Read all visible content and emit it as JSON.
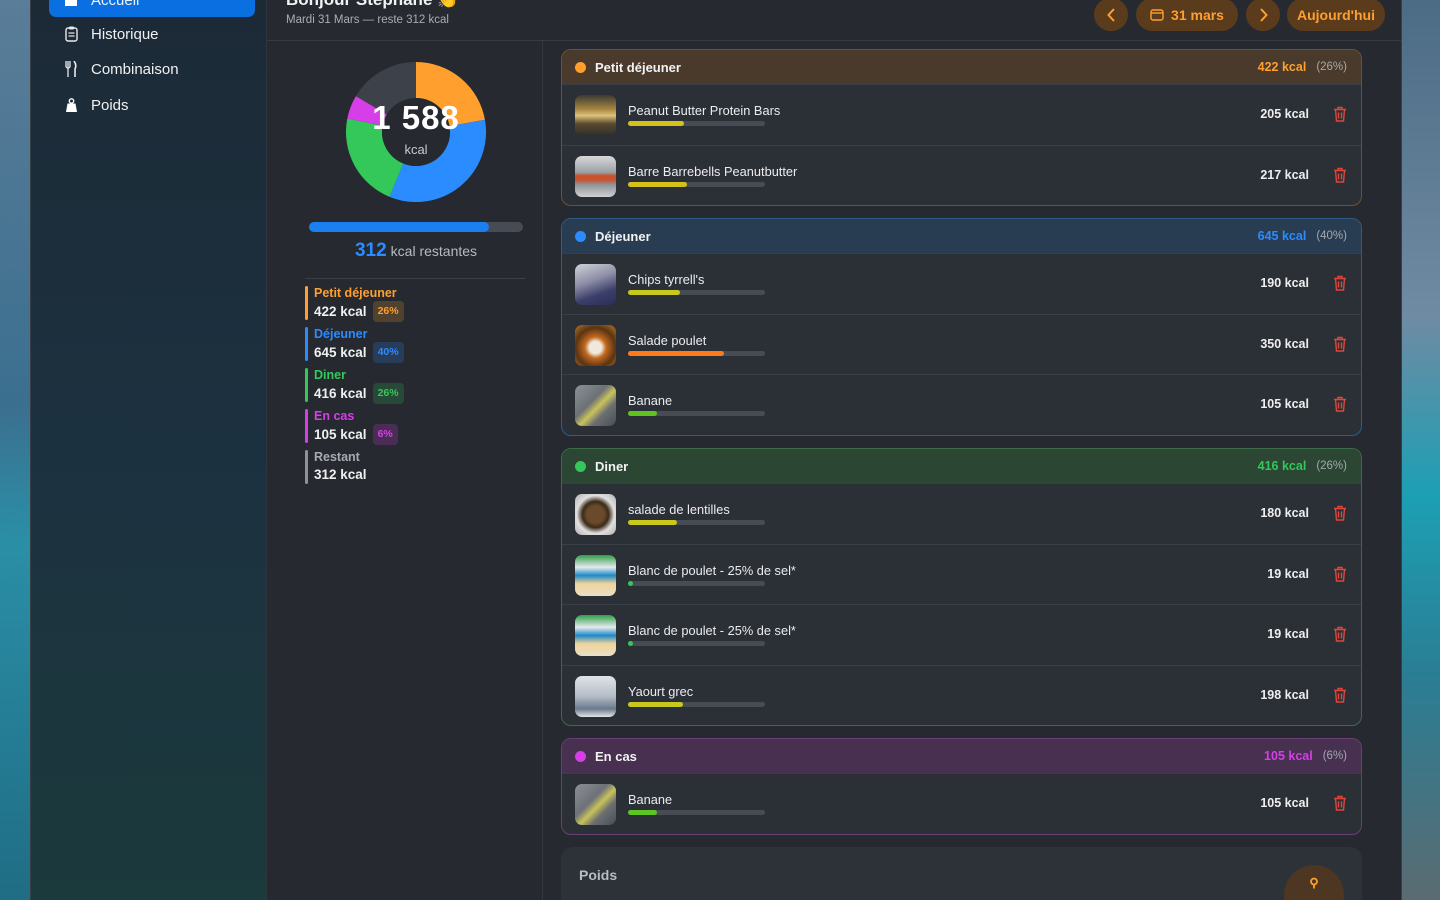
{
  "sidebar": {
    "items": [
      {
        "label": "Accueil",
        "icon": "home-icon"
      },
      {
        "label": "Historique",
        "icon": "clipboard-icon"
      },
      {
        "label": "Combinaison",
        "icon": "fork-knife-icon"
      },
      {
        "label": "Poids",
        "icon": "weight-icon"
      }
    ]
  },
  "header": {
    "greeting": "Bonjour Stéphane 👏",
    "subtitle": "Mardi 31 Mars — reste 312 kcal",
    "date_label": "31 mars",
    "today_label": "Aujourd'hui"
  },
  "summary": {
    "total": "1 588",
    "unit": "kcal",
    "remaining_value": "312",
    "remaining_label": "kcal restantes",
    "progress_fraction": 0.84,
    "legend": [
      {
        "name": "Petit déjeuner",
        "kcal": "422 kcal",
        "pct": "26%",
        "color": "#ff9f2e"
      },
      {
        "name": "Déjeuner",
        "kcal": "645 kcal",
        "pct": "40%",
        "color": "#2b8cff"
      },
      {
        "name": "Diner",
        "kcal": "416 kcal",
        "pct": "26%",
        "color": "#34c759"
      },
      {
        "name": "En cas",
        "kcal": "105 kcal",
        "pct": "6%",
        "color": "#d63ee8"
      },
      {
        "name": "Restant",
        "kcal": "312 kcal",
        "pct": "",
        "color": "#8e9299"
      }
    ]
  },
  "meals": [
    {
      "title": "Petit déjeuner",
      "kcal": "422 kcal",
      "pct": "(26%)",
      "color": "#ff9f2e",
      "items": [
        {
          "name": "Peanut Butter Protein Bars",
          "kcal": "205 kcal",
          "fill": 0.41,
          "bar_color": "#d4c21a"
        },
        {
          "name": "Barre Barrebells Peanutbutter",
          "kcal": "217 kcal",
          "fill": 0.43,
          "bar_color": "#d4c21a"
        }
      ]
    },
    {
      "title": "Déjeuner",
      "kcal": "645 kcal",
      "pct": "(40%)",
      "color": "#2b8cff",
      "items": [
        {
          "name": "Chips tyrrell's",
          "kcal": "190 kcal",
          "fill": 0.38,
          "bar_color": "#c8c81e"
        },
        {
          "name": "Salade poulet",
          "kcal": "350 kcal",
          "fill": 0.7,
          "bar_color": "#ff7a1a"
        },
        {
          "name": "Banane",
          "kcal": "105 kcal",
          "fill": 0.21,
          "bar_color": "#5ec422"
        }
      ]
    },
    {
      "title": "Diner",
      "kcal": "416 kcal",
      "pct": "(26%)",
      "color": "#34c759",
      "items": [
        {
          "name": "salade de lentilles",
          "kcal": "180 kcal",
          "fill": 0.36,
          "bar_color": "#c8c81e"
        },
        {
          "name": "Blanc de poulet - 25% de sel*",
          "kcal": "19 kcal",
          "fill": 0.04,
          "bar_color": "#34c759"
        },
        {
          "name": "Blanc de poulet - 25% de sel*",
          "kcal": "19 kcal",
          "fill": 0.04,
          "bar_color": "#34c759"
        },
        {
          "name": "Yaourt grec",
          "kcal": "198 kcal",
          "fill": 0.4,
          "bar_color": "#c8c81e"
        }
      ]
    },
    {
      "title": "En cas",
      "kcal": "105 kcal",
      "pct": "(6%)",
      "color": "#d63ee8",
      "items": [
        {
          "name": "Banane",
          "kcal": "105 kcal",
          "fill": 0.21,
          "bar_color": "#5ec422"
        }
      ]
    }
  ],
  "poids": {
    "title": "Poids"
  }
}
